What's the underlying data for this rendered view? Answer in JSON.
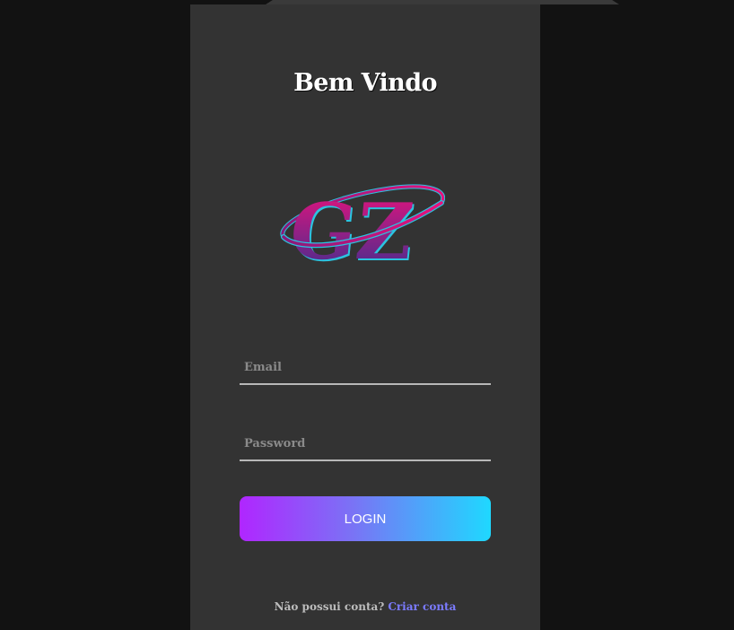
{
  "header": {
    "title": "Bem Vindo"
  },
  "logo": {
    "text": "GZ",
    "colors": [
      "#e8127c",
      "#3d2f8f",
      "#2bc3e0"
    ]
  },
  "form": {
    "email": {
      "placeholder": "Email",
      "value": ""
    },
    "password": {
      "placeholder": "Password",
      "value": ""
    },
    "login_label": "LOGIN"
  },
  "footer": {
    "prompt": "Não possui conta?",
    "signup_link": "Criar conta"
  },
  "theme": {
    "background": "#121212",
    "card": "#333333",
    "button_gradient": [
      "#b026ff",
      "#1fd8ff"
    ],
    "link": "#7b7bff"
  }
}
